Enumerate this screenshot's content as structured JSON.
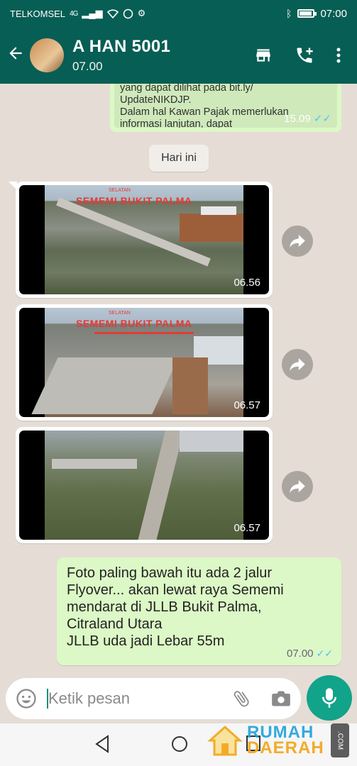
{
  "statusbar": {
    "carrier": "TELKOMSEL",
    "network": "4G",
    "time": "07:00"
  },
  "header": {
    "contact_name": "A HAN 5001",
    "subtitle": "07.00",
    "icons": [
      "back-arrow-icon",
      "store-icon",
      "add-call-icon",
      "more-vert-icon"
    ]
  },
  "chat": {
    "top_message": {
      "lines": "yang dapat dilihat pada bit.ly/\nUpdateNIKDJP.\nDalam hal Kawan Pajak memerlukan\ninformasi lanjutan, dapat",
      "time": "15.09"
    },
    "day_label": "Hari ini",
    "videos": [
      {
        "overlay_small": "SELATAN",
        "overlay": "SEMEMI BUKIT PALMA",
        "duration": "06.56"
      },
      {
        "overlay_small": "SELATAN",
        "overlay": "SEMEMI BUKIT PALMA",
        "duration": "06.57"
      },
      {
        "overlay_small": "",
        "overlay": "",
        "duration": "06.57"
      }
    ],
    "outgoing": {
      "text": "Foto paling bawah itu ada 2 jalur\nFlyover... akan lewat raya Sememi\nmendarat di JLLB Bukit Palma,\nCitraland Utara\nJLLB uda jadi Lebar 55m",
      "time": "07.00"
    }
  },
  "composer": {
    "placeholder": "Ketik pesan"
  },
  "watermark": {
    "line1": "RUMAH",
    "line2": "DAERAH",
    "suffix": ".COM"
  },
  "colors": {
    "header": "#075e54",
    "outgoing": "#dcf8c6",
    "chat_bg": "#e5ddd5",
    "accent": "#12a38b",
    "read_ticks": "#4fc3f7"
  }
}
